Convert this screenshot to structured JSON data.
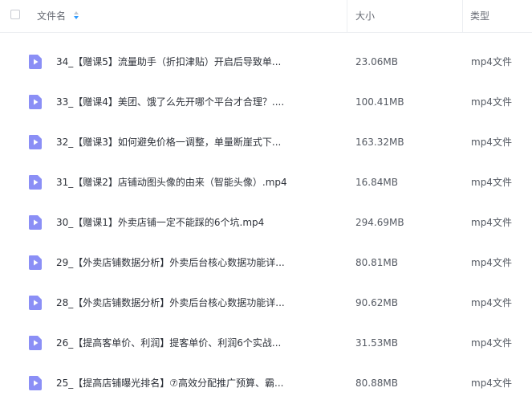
{
  "header": {
    "name_label": "文件名",
    "size_label": "大小",
    "type_label": "类型"
  },
  "colors": {
    "video_icon": "#8b8ff6",
    "sort_up": "#c3c6cd",
    "sort_down": "#2f9bff"
  },
  "files": [
    {
      "name": "34_【赠课5】流量助手（折扣津贴）开启后导致单...",
      "size": "23.06MB",
      "type": "mp4文件"
    },
    {
      "name": "33_【赠课4】美团、饿了么先开哪个平台才合理？....",
      "size": "100.41MB",
      "type": "mp4文件"
    },
    {
      "name": "32_【赠课3】如何避免价格一调整，单量断崖式下...",
      "size": "163.32MB",
      "type": "mp4文件"
    },
    {
      "name": "31_【赠课2】店铺动图头像的由来（智能头像）.mp4",
      "size": "16.84MB",
      "type": "mp4文件"
    },
    {
      "name": "30_【赠课1】外卖店铺一定不能踩的6个坑.mp4",
      "size": "294.69MB",
      "type": "mp4文件"
    },
    {
      "name": "29_【外卖店铺数据分析】外卖后台核心数据功能详...",
      "size": "80.81MB",
      "type": "mp4文件"
    },
    {
      "name": "28_【外卖店铺数据分析】外卖后台核心数据功能详...",
      "size": "90.62MB",
      "type": "mp4文件"
    },
    {
      "name": "26_【提高客单价、利润】提客单价、利润6个实战...",
      "size": "31.53MB",
      "type": "mp4文件"
    },
    {
      "name": "25_【提高店铺曝光排名】⑦高效分配推广预算、霸...",
      "size": "80.88MB",
      "type": "mp4文件"
    }
  ]
}
